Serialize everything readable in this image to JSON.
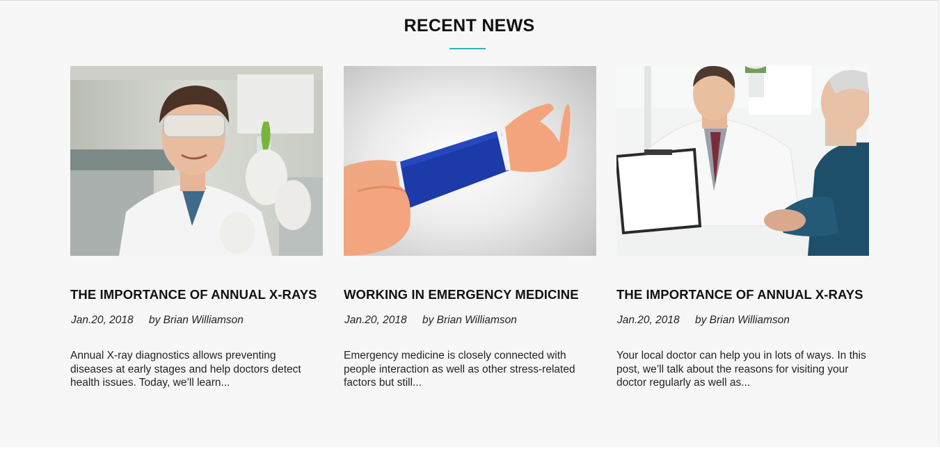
{
  "section": {
    "title": "RECENT NEWS",
    "accent_color": "#2bb3c0"
  },
  "posts": [
    {
      "image": "scientist-with-test-tube-photo",
      "title": "THE IMPORTANCE OF ANNUAL X-RAYS",
      "date": "Jan.20, 2018",
      "author": "by Brian Williamson",
      "excerpt": "Annual X-ray diagnostics allows preventing diseases at early stages and help doctors detect health issues. Today, we’ll learn..."
    },
    {
      "image": "wrist-support-bandage-photo",
      "title": "WORKING IN EMERGENCY MEDICINE",
      "date": "Jan.20, 2018",
      "author": "by Brian Williamson",
      "excerpt": "Emergency medicine is closely connected with people interaction as well as other stress-related factors but still..."
    },
    {
      "image": "doctor-with-patient-photo",
      "title": "THE IMPORTANCE OF ANNUAL X-RAYS",
      "date": "Jan.20, 2018",
      "author": "by Brian Williamson",
      "excerpt": "Your local doctor can help you in lots of ways. In this post, we’ll talk about the reasons for visiting your doctor regularly as well as..."
    }
  ]
}
